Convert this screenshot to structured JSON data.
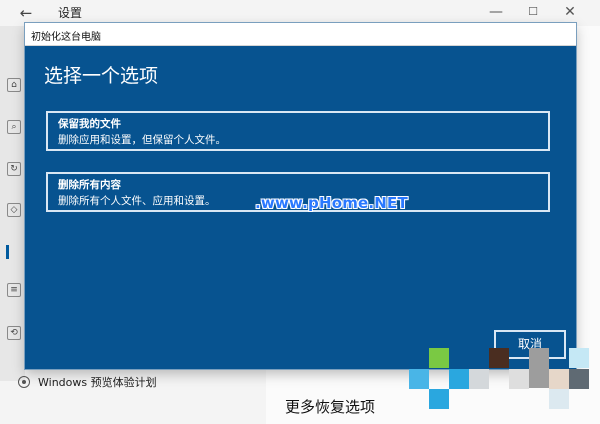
{
  "background_window": {
    "title": "设置",
    "back_glyph": "←",
    "window_controls": {
      "minimize": "—",
      "maximize": "☐",
      "close": "✕"
    },
    "left_icons": [
      "home-icon",
      "search-icon",
      "update-icon",
      "shield-icon",
      "recovery-icon",
      "developer-icon"
    ],
    "insider_label": "Windows 预览体验计划",
    "more_recovery_label": "更多恢复选项"
  },
  "dialog": {
    "title": "初始化这台电脑",
    "heading": "选择一个选项",
    "options": [
      {
        "title": "保留我的文件",
        "description": "删除应用和设置，但保留个人文件。"
      },
      {
        "title": "删除所有内容",
        "description": "删除所有个人文件、应用和设置。"
      }
    ],
    "cancel_label": "取消"
  },
  "watermark": {
    "text": ".www.pHome.NET",
    "pixel_colors": [
      "#7ac943",
      "#4a2d20",
      "#2aa7df",
      "#9d9d9d",
      "#c5e8f5",
      "#e6d7c9",
      "#5f6a73",
      "#dce9f0"
    ]
  },
  "colors": {
    "dialog_background": "#075390",
    "button_border": "#d9e7f4",
    "heading_text": "#ffffff"
  }
}
